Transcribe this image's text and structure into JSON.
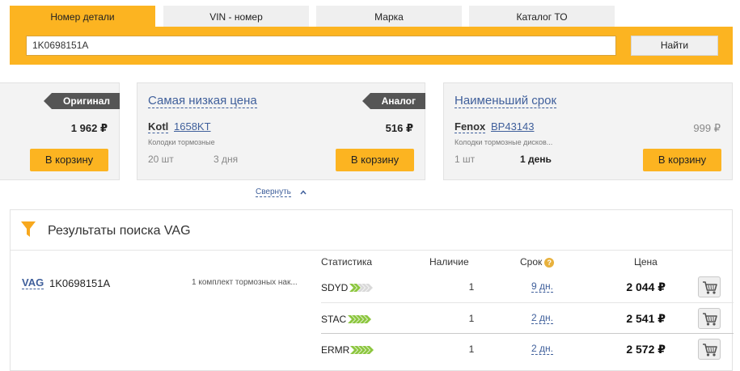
{
  "tabs": [
    "Номер детали",
    "VIN - номер",
    "Марка",
    "Каталог ТО"
  ],
  "search": {
    "value": "1K0698151A",
    "button": "Найти"
  },
  "cards": [
    {
      "ribbon": "Оригинал",
      "price": "1 962 ₽",
      "cart": "В корзину"
    },
    {
      "title": "Самая низкая цена",
      "ribbon": "Аналог",
      "brand": "Kotl",
      "article": "1658KT",
      "desc": "Колодки тормозные",
      "price": "516 ₽",
      "qty": "20 шт",
      "term": "3 дня",
      "cart": "В корзину"
    },
    {
      "title": "Наименьший срок",
      "brand": "Fenox",
      "article": "BP43143",
      "desc": "Колодки тормозные дисков...",
      "price": "999 ₽",
      "qty": "1 шт",
      "term": "1 день",
      "cart": "В корзину"
    }
  ],
  "collapse": "Свернуть",
  "results": {
    "title": "Результаты поиска VAG",
    "columns": {
      "stats": "Статистика",
      "stock": "Наличие",
      "term": "Срок",
      "help": "?",
      "price": "Цена"
    },
    "item": {
      "brand": "VAG",
      "article": "1K0698151A",
      "desc": "1 комплект тормозных нак..."
    },
    "rows": [
      {
        "supplier": "SDYD",
        "qty": "1",
        "term": "9 дн.",
        "price": "2 044 ₽",
        "rating": 0.33
      },
      {
        "supplier": "STAC",
        "qty": "1",
        "term": "2 дн.",
        "price": "2 541 ₽",
        "rating": 1
      },
      {
        "supplier": "ERMR",
        "qty": "1",
        "term": "2 дн.",
        "price": "2 572 ₽",
        "rating": 1
      }
    ]
  },
  "colors": {
    "accent": "#fcb421",
    "link": "#3f5f9b",
    "ribbon": "#555555",
    "rating_on": "#8cc63f",
    "rating_off": "#d9d9d9"
  }
}
